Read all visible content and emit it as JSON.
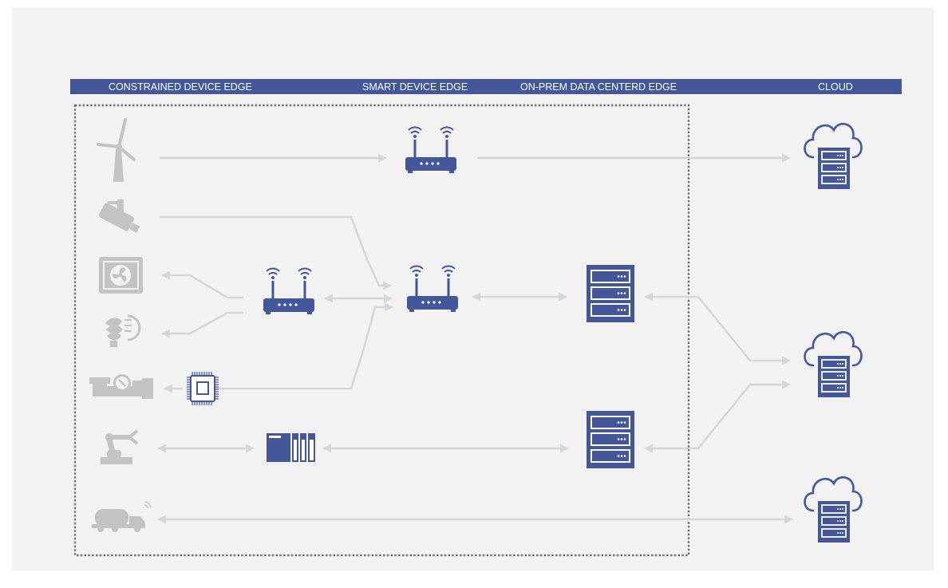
{
  "header": {
    "zones": [
      {
        "label": "CONSTRAINED DEVICE EDGE"
      },
      {
        "label": "SMART DEVICE EDGE"
      },
      {
        "label": "ON-PREM DATA CENTERD EDGE"
      },
      {
        "label": "CLOUD"
      }
    ]
  },
  "colors": {
    "header_bar": "#44579b",
    "header_text": "#ffffff",
    "panel_background": "#f2f2f2",
    "device_icon": "#44579b",
    "endpoint_icon": "#c3c3c3",
    "connector": "#d6d6d6",
    "boundary": "#6e6e6e"
  },
  "endpoints": [
    {
      "icon": "wind-turbine-icon"
    },
    {
      "icon": "security-camera-icon"
    },
    {
      "icon": "hvac-fan-icon"
    },
    {
      "icon": "smart-bulb-icon"
    },
    {
      "icon": "flow-meter-pipe-icon"
    },
    {
      "icon": "robotic-arm-icon"
    },
    {
      "icon": "tanker-truck-icon"
    }
  ],
  "edge_devices": [
    {
      "icon": "router-icon",
      "role": "wind-turbine-gateway"
    },
    {
      "icon": "router-icon",
      "role": "local-hub"
    },
    {
      "icon": "router-icon",
      "role": "aggregation-gateway"
    },
    {
      "icon": "microcontroller-chip-icon"
    },
    {
      "icon": "plc-controller-icon"
    },
    {
      "icon": "server-rack-icon",
      "role": "on-prem-server-upper"
    },
    {
      "icon": "server-rack-icon",
      "role": "on-prem-server-lower"
    }
  ],
  "cloud_nodes": [
    {
      "icon": "cloud-server-icon",
      "role": "cloud-top"
    },
    {
      "icon": "cloud-server-icon",
      "role": "cloud-middle"
    },
    {
      "icon": "cloud-server-icon",
      "role": "cloud-bottom"
    }
  ],
  "boundary": {
    "style": "dotted",
    "encloses": [
      "constrained-device-edge",
      "smart-device-edge",
      "on-prem-data-center-edge"
    ]
  }
}
